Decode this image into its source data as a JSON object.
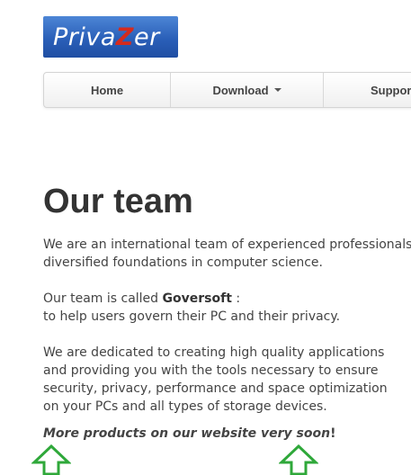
{
  "logo": {
    "text_before": "Priva",
    "text_z": "Z",
    "text_after": "er"
  },
  "nav": {
    "home": "Home",
    "download": "Download",
    "support": "Support"
  },
  "page_title": "Our team",
  "paragraphs": {
    "p1_line1": "We are an international team of experienced professionals",
    "p1_line2": "diversified foundations in computer science.",
    "p2_prefix": "Our team is called ",
    "p2_name": "Goversoft",
    "p2_suffix": " :",
    "p2_line2": "to help users govern their PC and their privacy.",
    "p3_line1": "We are dedicated to creating high quality applications",
    "p3_line2": "and providing you with the tools necessary to ensure",
    "p3_line3": "security, privacy, performance and space optimization",
    "p3_line4": "on your PCs and all types of storage devices.",
    "p4_text": "More products on our website very soon",
    "p4_bang": "!"
  },
  "colors": {
    "logo_bg": "#2a5fb8",
    "logo_z": "#d52b1e",
    "arrow": "#2fa83a"
  }
}
